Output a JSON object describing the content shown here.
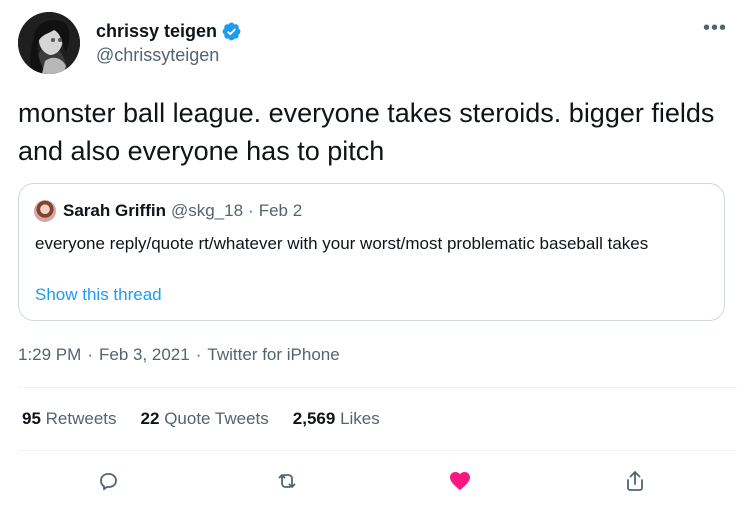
{
  "author": {
    "display_name": "chrissy teigen",
    "handle": "@chrissyteigen",
    "verified_badge_icon": "verified-badge-icon"
  },
  "tweet": {
    "text": "monster ball league. everyone takes steroids. bigger fields and also everyone has to pitch",
    "more_icon": "more-horizontal-icon"
  },
  "quoted_tweet": {
    "display_name": "Sarah Griffin",
    "handle": "@skg_18",
    "separator": "·",
    "date": "Feb 2",
    "text": "everyone reply/quote rt/whatever with your worst/most problematic baseball takes",
    "show_thread": "Show this thread"
  },
  "meta": {
    "time": "1:29 PM",
    "separator_1": "·",
    "date": "Feb 3, 2021",
    "separator_2": "·",
    "source": "Twitter for iPhone"
  },
  "stats": [
    {
      "number": "95",
      "label": "Retweets"
    },
    {
      "number": "22",
      "label": "Quote Tweets"
    },
    {
      "number": "2,569",
      "label": "Likes"
    }
  ],
  "actions": {
    "reply_icon": "reply-icon",
    "retweet_icon": "retweet-icon",
    "like_icon": "heart-icon",
    "share_icon": "share-icon"
  },
  "colors": {
    "accent": "#1d9bf0",
    "verified": "#1d9bf0",
    "like": "#f91880",
    "muted_text": "#536471",
    "border": "#cfd9de"
  }
}
